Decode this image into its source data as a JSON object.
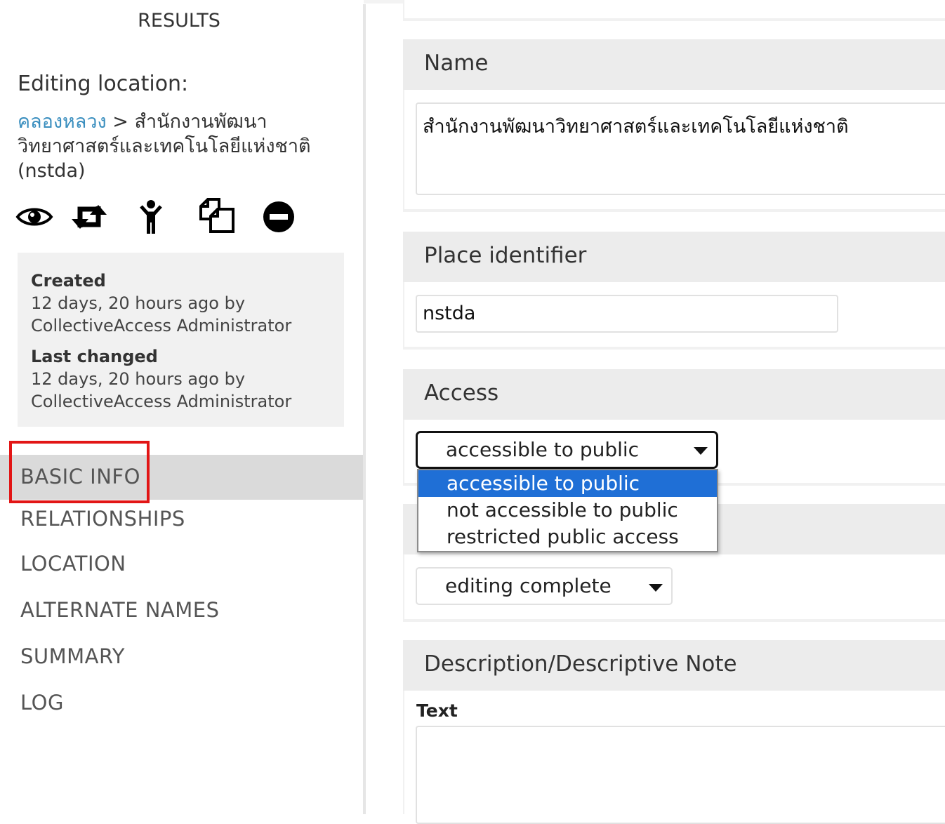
{
  "sidebar": {
    "results_link": "RESULTS",
    "editing_title": "Editing location:",
    "breadcrumb": {
      "parent": "คลองหลวง",
      "separator": ">",
      "current": "สำนักงานพัฒนาวิทยาศาสตร์และเทคโนโลยีแห่งชาติ (nstda)"
    },
    "actions": [
      {
        "icon": "eye-icon",
        "purpose": "view"
      },
      {
        "icon": "swap-icon",
        "purpose": "change type"
      },
      {
        "icon": "person-icon",
        "purpose": "inspect"
      },
      {
        "icon": "duplicate-icon",
        "purpose": "duplicate"
      },
      {
        "icon": "delete-icon",
        "purpose": "delete"
      }
    ],
    "info": {
      "created_label": "Created",
      "created_value": "12 days, 20 hours ago by CollectiveAccess Administrator",
      "changed_label": "Last changed",
      "changed_value": "12 days, 20 hours ago by CollectiveAccess Administrator"
    },
    "nav": [
      {
        "label": "BASIC INFO",
        "active": true
      },
      {
        "label": "RELATIONSHIPS"
      },
      {
        "label": "LOCATION"
      },
      {
        "label": "ALTERNATE NAMES"
      },
      {
        "label": "SUMMARY"
      },
      {
        "label": "LOG"
      }
    ]
  },
  "form": {
    "name": {
      "label": "Name",
      "value": "สำนักงานพัฒนาวิทยาศาสตร์และเทคโนโลยีแห่งชาติ"
    },
    "place_identifier": {
      "label": "Place identifier",
      "value": "nstda"
    },
    "access": {
      "label": "Access",
      "selected": "accessible to public",
      "options": [
        "accessible to public",
        "not accessible to public",
        "restricted public access"
      ]
    },
    "status": {
      "selected": "editing complete"
    },
    "description": {
      "label": "Description/Descriptive Note",
      "text_label": "Text",
      "value": ""
    }
  },
  "colors": {
    "link": "#3b8fbf",
    "highlight_box": "#e21515",
    "selected_option": "#1f6fd6"
  }
}
